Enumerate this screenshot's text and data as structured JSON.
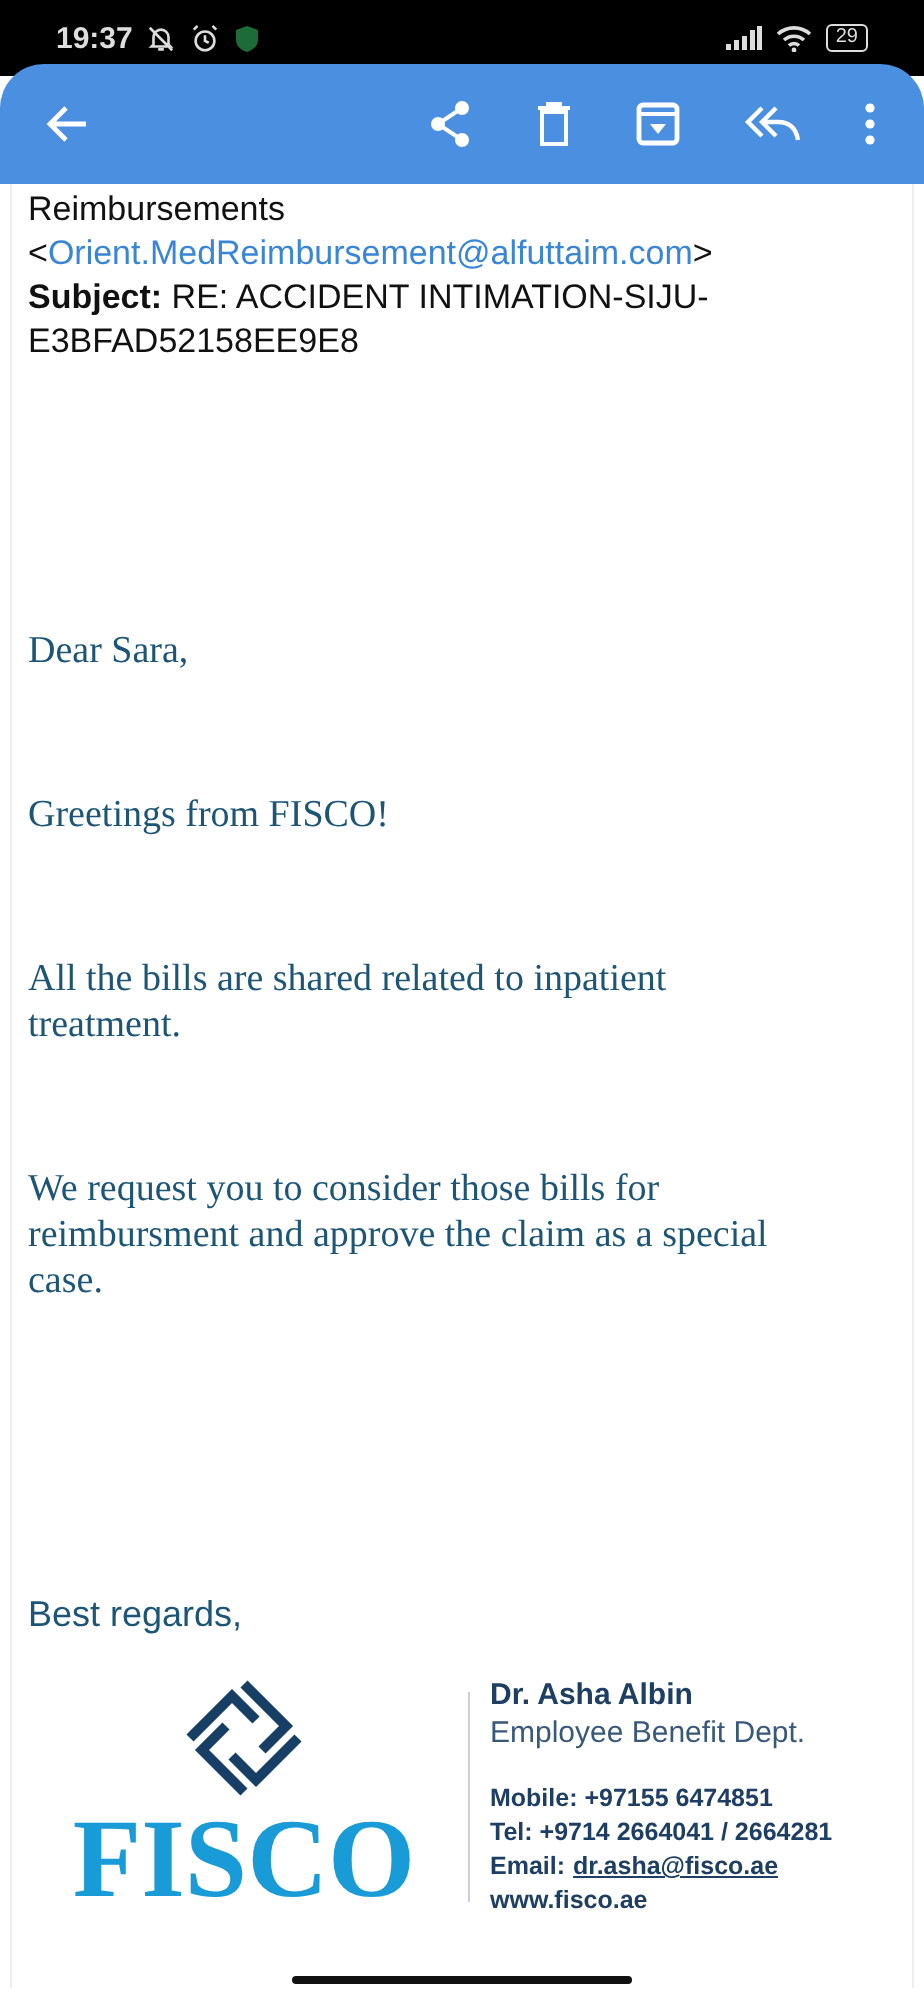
{
  "status_bar": {
    "time": "19:37",
    "battery": "29"
  },
  "header": {
    "from_name": "Reimbursements",
    "address_open": "<",
    "from_address": "Orient.MedReimbursement@alfuttaim.com",
    "address_close": ">",
    "subject_label": "Subject:",
    "subject": "RE: ACCIDENT INTIMATION-SIJU-E3BFAD52158EE9E8"
  },
  "body": [
    "Dear Sara,",
    "Greetings from FISCO!",
    "All the bills are shared related to inpatient treatment.",
    "We request you to consider those bills for reimbursment and approve the claim as a special case."
  ],
  "closing": "Best regards,",
  "signature": {
    "logo": "FISCO",
    "name": "Dr. Asha Albin",
    "department": "Employee Benefit Dept.",
    "mobile": "Mobile: +97155 6474851",
    "tel": "Tel: +9714 2664041 / 2664281",
    "email_label": "Email:",
    "email": "dr.asha@fisco.ae",
    "website": "www.fisco.ae"
  }
}
